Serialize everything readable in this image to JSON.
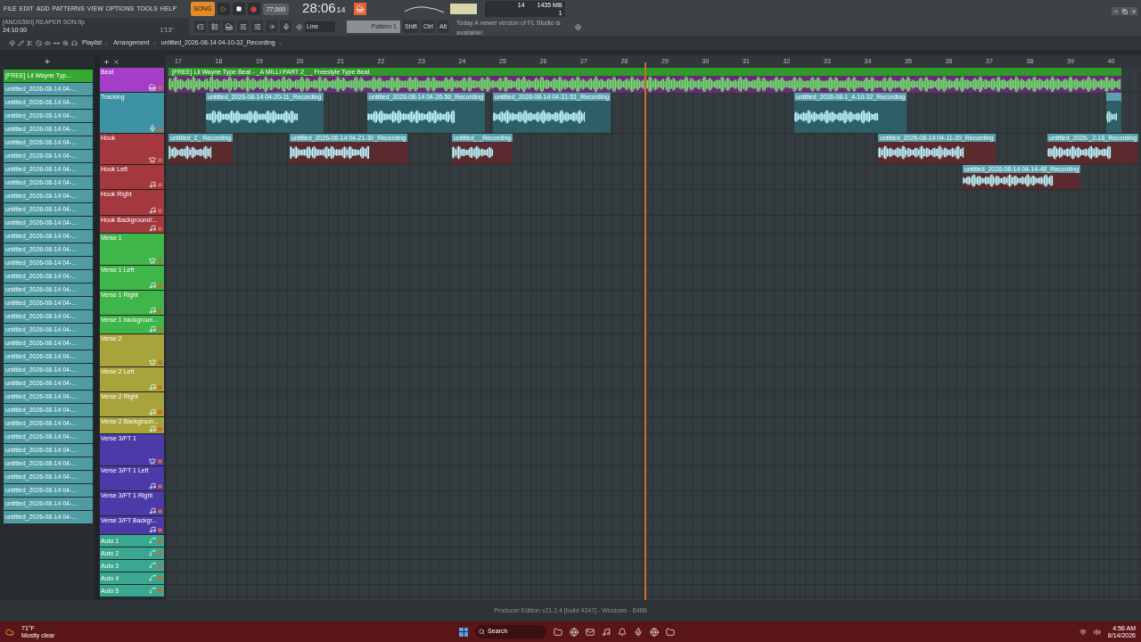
{
  "menu": [
    "FILE",
    "EDIT",
    "ADD",
    "PATTERNS",
    "VIEW",
    "OPTIONS",
    "TOOLS",
    "HELP"
  ],
  "transport": {
    "mode": "SONG",
    "tempo": "77.000",
    "time": "28:06",
    "ticks": "14"
  },
  "song": {
    "file": "[ANDS560] REAPER SON.flp",
    "length": "24:10:00",
    "position": "1'13''"
  },
  "monitor": {
    "cpu": "14",
    "memory": "1435 MB",
    "voices": "1"
  },
  "snap": "Line",
  "pattern": "Pattern 1",
  "modifiers": [
    "Shift",
    "Ctrl",
    "Alt"
  ],
  "hint": {
    "prefix": "Today",
    "text": "A newer version of FL Studio is available!"
  },
  "breadcrumb": [
    "Playlist",
    "Arrangement",
    "untitled_2026-08-14 04-10-32_Recording"
  ],
  "clip_list": [
    {
      "name": "[FREE] Lil Wayne Typ...",
      "selected": true
    },
    {
      "name": "untitled_2026-08-14 04-...",
      "selected": false
    },
    {
      "name": "untitled_2026-08-14 04-...",
      "selected": false
    },
    {
      "name": "untitled_2026-08-14 04-...",
      "selected": false
    },
    {
      "name": "untitled_2026-08-14 04-...",
      "selected": false
    },
    {
      "name": "untitled_2026-08-14 04-...",
      "selected": false
    },
    {
      "name": "untitled_2026-08-14 04-...",
      "selected": false
    },
    {
      "name": "untitled_2026-08-14 04-...",
      "selected": false
    },
    {
      "name": "untitled_2026-08-14 04-...",
      "selected": false
    },
    {
      "name": "untitled_2026-08-14 04-...",
      "selected": false
    },
    {
      "name": "untitled_2026-08-14 04-...",
      "selected": false
    },
    {
      "name": "untitled_2026-08-14 04-...",
      "selected": false
    },
    {
      "name": "untitled_2026-08-14 04-...",
      "selected": false
    },
    {
      "name": "untitled_2026-08-14 04-...",
      "selected": false
    },
    {
      "name": "untitled_2026-08-14 04-...",
      "selected": false
    },
    {
      "name": "untitled_2026-08-14 04-...",
      "selected": false
    },
    {
      "name": "untitled_2026-08-14 04-...",
      "selected": false
    },
    {
      "name": "untitled_2026-08-14 04-...",
      "selected": false
    },
    {
      "name": "untitled_2026-08-14 04-...",
      "selected": false
    },
    {
      "name": "untitled_2026-08-14 04-...",
      "selected": false
    },
    {
      "name": "untitled_2026-08-14 04-...",
      "selected": false
    },
    {
      "name": "untitled_2026-08-14 04-...",
      "selected": false
    },
    {
      "name": "untitled_2026-08-14 04-...",
      "selected": false
    },
    {
      "name": "untitled_2026-08-14 04-...",
      "selected": false
    },
    {
      "name": "untitled_2026-08-14 04-...",
      "selected": false
    },
    {
      "name": "untitled_2026-08-14 04-...",
      "selected": false
    },
    {
      "name": "untitled_2026-08-14 04-...",
      "selected": false
    },
    {
      "name": "untitled_2026-08-14 04-...",
      "selected": false
    },
    {
      "name": "untitled_2026-08-14 04-...",
      "selected": false
    },
    {
      "name": "untitled_2026-08-14 04-...",
      "selected": false
    },
    {
      "name": "untitled_2026-08-14 04-...",
      "selected": false
    },
    {
      "name": "untitled_2026-08-14 04-...",
      "selected": false
    },
    {
      "name": "untitled_2026-08-14 04-...",
      "selected": false
    },
    {
      "name": "untitled_2026-08-14 04-...",
      "selected": false
    }
  ],
  "ruler": [
    "17",
    "18",
    "19",
    "20",
    "21",
    "22",
    "23",
    "24",
    "25",
    "26",
    "27",
    "28",
    "29",
    "30",
    "31",
    "32",
    "33",
    "34",
    "35",
    "36",
    "37",
    "38",
    "39",
    "40"
  ],
  "tracks": [
    {
      "name": "Beat",
      "color": "#a43ec6",
      "kind": "instrument",
      "clips": [
        {
          "title": "[FREE] Lil Wayne Type Beat - _A MILLI PART 2_ _ Freestyle Type Beat",
          "kind": "beat"
        }
      ]
    },
    {
      "name": "Tracking",
      "color": "#3d93a3",
      "kind": "audio",
      "clips": [
        {
          "title": "untitled_2026-08-14 04-20-11_Recording",
          "kind": "audio"
        },
        {
          "title": "untitled_2026-08-14 04-26-56_Recording",
          "kind": "audio"
        },
        {
          "title": "untitled_2026-08-14 04-31-51_Recording",
          "kind": "audio"
        },
        {
          "title": "untitled_2026-08-1_4-10-32_Recording",
          "kind": "audio"
        },
        {
          "kind": "audio"
        }
      ]
    },
    {
      "name": "Hook",
      "color": "#a3383f",
      "kind": "group",
      "clips": [
        {
          "title": "untitled_2_ Recording",
          "kind": "audio"
        },
        {
          "title": "untitled_2026-08-14 04-21-30_Recording",
          "kind": "audio"
        },
        {
          "title": "untitled_ _Recording",
          "kind": "audio"
        },
        {
          "title": "untitled_2026-08-14 04-11-20_Recording",
          "kind": "audio"
        },
        {
          "title": "untitled_2026-_2-18_Recording",
          "kind": "audio"
        }
      ]
    },
    {
      "name": "Hook Left",
      "color": "#a3383f",
      "kind": "note",
      "clips": [
        {
          "title": "untitled_2026-08-14 04-14-48_Recording",
          "kind": "audio"
        }
      ]
    },
    {
      "name": "Hook Right",
      "color": "#a3383f",
      "kind": "note"
    },
    {
      "name": "Hook Background/...",
      "color": "#a3383f",
      "kind": "note"
    },
    {
      "name": "Verse 1",
      "color": "#3fb54a",
      "kind": "group"
    },
    {
      "name": "Verse 1 Left",
      "color": "#3fb54a",
      "kind": "note"
    },
    {
      "name": "Verse 1 Right",
      "color": "#3fb54a",
      "kind": "note"
    },
    {
      "name": "Verse 1 backgroun...",
      "color": "#3fb54a",
      "kind": "note"
    },
    {
      "name": "Verse 2",
      "color": "#a8a33a",
      "kind": "group"
    },
    {
      "name": "Verse 2 Left",
      "color": "#a8a33a",
      "kind": "note"
    },
    {
      "name": "Verse 2 Right",
      "color": "#a8a33a",
      "kind": "note"
    },
    {
      "name": "Verse 2 Backgroun...",
      "color": "#a8a33a",
      "kind": "note"
    },
    {
      "name": "Verse 3/FT 1",
      "color": "#4b3aa8",
      "kind": "group"
    },
    {
      "name": "Verse 3/FT 1 Left",
      "color": "#4b3aa8",
      "kind": "note"
    },
    {
      "name": "Verse 3/FT 1 Right",
      "color": "#4b3aa8",
      "kind": "note"
    },
    {
      "name": "Verse 3/FT Backgr...",
      "color": "#4b3aa8",
      "kind": "note"
    },
    {
      "name": "Auto 1",
      "color": "#3aa890",
      "kind": "automation"
    },
    {
      "name": "Auto 2",
      "color": "#3aa890",
      "kind": "automation"
    },
    {
      "name": "Auto 3",
      "color": "#3aa890",
      "kind": "automation"
    },
    {
      "name": "Auto 4",
      "color": "#3aa890",
      "kind": "automation"
    },
    {
      "name": "Auto 5",
      "color": "#3aa890",
      "kind": "automation"
    }
  ],
  "status": "Producer Edition v21.2.4 [build 4247] - Windows - 64Bit",
  "taskbar": {
    "temperature": "71°F",
    "weather": "Mostly clear",
    "search": "Search",
    "time": "4:56 AM",
    "date": "8/14/2026"
  }
}
